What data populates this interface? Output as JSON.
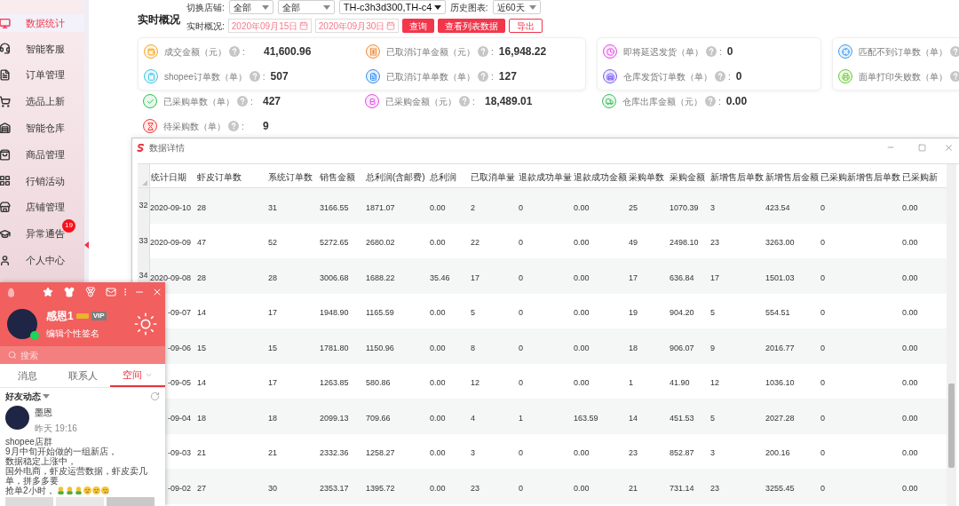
{
  "sidebar": {
    "items": [
      {
        "label": "数据统计",
        "selected": true
      },
      {
        "label": "智能客服",
        "selected": false
      },
      {
        "label": "订单管理",
        "selected": false
      },
      {
        "label": "选品上新",
        "selected": false
      },
      {
        "label": "智能仓库",
        "selected": false
      },
      {
        "label": "商品管理",
        "selected": false
      },
      {
        "label": "行销活动",
        "selected": false
      },
      {
        "label": "店铺管理",
        "selected": false
      },
      {
        "label": "异常通告",
        "selected": false,
        "badge": "19"
      },
      {
        "label": "个人中心",
        "selected": false
      }
    ]
  },
  "overview": {
    "title": "实时概况",
    "filters": {
      "store_label": "切换店铺:",
      "store_selects": [
        "全部",
        "全部",
        "TH-c3h3d300,TH-c4"
      ],
      "history_label": "历史图表:",
      "history_select": "近60天",
      "range_label": "实时概况:",
      "start_date": "2020年09月15日",
      "end_date": "2020年09月30日",
      "buttons": [
        {
          "label": "查询",
          "kind": "primary"
        },
        {
          "label": "查看列表数据",
          "kind": "primary"
        },
        {
          "label": "导出",
          "kind": "outline"
        }
      ]
    },
    "stat_panels": [
      {
        "card_rows": [
          [
            {
              "label": "成交金额（元）",
              "separator": ":",
              "value": "41,600.96"
            },
            {
              "label": "已取消订单金额（元）",
              "separator": ":",
              "value": "16,948.22"
            }
          ],
          [
            {
              "label": "shopee订单数（单）",
              "separator": ":",
              "value": "507"
            },
            {
              "label": "已取消订单单数（单）",
              "separator": ":",
              "value": "127"
            }
          ]
        ],
        "rows_below": [
          [
            {
              "label": "已采购单数（单）",
              "separator": ":",
              "value": "427"
            },
            {
              "label": "已采购金额（元）",
              "separator": ":",
              "value": "18,489.01"
            }
          ],
          [
            {
              "label": "待采购数（单）",
              "separator": ":",
              "value": "9"
            }
          ]
        ]
      },
      {
        "card_rows": [
          [
            {
              "label": "即将延迟发货（单）",
              "separator": ":",
              "value": "0"
            }
          ],
          [
            {
              "label": "仓库发货订单数（单）",
              "separator": ":",
              "value": "0"
            }
          ]
        ],
        "rows_below": [
          [
            {
              "label": "仓库出库金额（元）",
              "separator": ":",
              "value": "0.00"
            }
          ]
        ]
      },
      {
        "card_rows": [
          [
            {
              "label": "匹配不到订单数（单）"
            }
          ],
          [
            {
              "label": "面单打印失败数（单）"
            }
          ]
        ]
      }
    ]
  },
  "data_window": {
    "title": "数据详情",
    "table": {
      "columns": [
        "统计日期",
        "虾皮订单数",
        "系统订单数",
        "销售金额",
        "总利润(含邮费)",
        "总利润",
        "已取消单量",
        "退款成功单量",
        "退款成功金额",
        "采购单数",
        "采购金额",
        "新增售后单数",
        "新增售后金额",
        "已采购新增售后单数",
        "已采购新"
      ],
      "rows": [
        {
          "row_number": "32",
          "cells": [
            "2020-09-10",
            "28",
            "31",
            "3166.55",
            "1871.07",
            "0.00",
            "2",
            "0",
            "0.00",
            "25",
            "1070.39",
            "3",
            "423.54",
            "0",
            "0.00"
          ]
        },
        {
          "row_number": "33",
          "cells": [
            "2020-09-09",
            "47",
            "52",
            "5272.65",
            "2680.02",
            "0.00",
            "22",
            "0",
            "0.00",
            "49",
            "2498.10",
            "23",
            "3263.00",
            "0",
            "0.00"
          ]
        },
        {
          "row_number": "34",
          "cells": [
            "2020-09-08",
            "28",
            "28",
            "3006.68",
            "1688.22",
            "35.46",
            "17",
            "0",
            "0.00",
            "17",
            "636.84",
            "17",
            "1501.03",
            "0",
            "0.00"
          ]
        },
        {
          "cells": [
            "-09-07",
            "14",
            "17",
            "1948.90",
            "1165.59",
            "0.00",
            "5",
            "0",
            "0.00",
            "19",
            "904.20",
            "5",
            "554.51",
            "0",
            "0.00"
          ]
        },
        {
          "cells": [
            "-09-06",
            "15",
            "15",
            "1781.80",
            "1150.96",
            "0.00",
            "8",
            "0",
            "0.00",
            "18",
            "906.07",
            "9",
            "2016.77",
            "0",
            "0.00"
          ]
        },
        {
          "cells": [
            "-09-05",
            "14",
            "17",
            "1263.85",
            "580.86",
            "0.00",
            "12",
            "0",
            "0.00",
            "1",
            "41.90",
            "12",
            "1036.10",
            "0",
            "0.00"
          ]
        },
        {
          "cells": [
            "-09-04",
            "18",
            "18",
            "2099.13",
            "709.66",
            "0.00",
            "4",
            "1",
            "163.59",
            "14",
            "451.53",
            "5",
            "2027.28",
            "0",
            "0.00"
          ]
        },
        {
          "cells": [
            "-09-03",
            "21",
            "21",
            "2332.36",
            "1258.27",
            "0.00",
            "3",
            "0",
            "0.00",
            "23",
            "852.87",
            "3",
            "200.16",
            "0",
            "0.00"
          ]
        },
        {
          "cells": [
            "-09-02",
            "27",
            "30",
            "2353.17",
            "1395.72",
            "0.00",
            "23",
            "0",
            "0.00",
            "21",
            "731.14",
            "23",
            "3255.45",
            "0",
            "0.00"
          ]
        }
      ]
    }
  },
  "chat_window": {
    "profile": {
      "name": "感恩1",
      "vip": "VIP",
      "signature": "编辑个性签名",
      "online": true
    },
    "search": {
      "placeholder": "搜索"
    },
    "tabs": [
      {
        "label": "消息",
        "selected": false
      },
      {
        "label": "联系人",
        "selected": false
      },
      {
        "label": "空间",
        "selected": true
      }
    ],
    "feed": {
      "title": "好友动态",
      "posts": [
        {
          "author": "墨恩",
          "time": "昨天 19:16",
          "lines": [
            "shopee店群",
            "9月中旬开始做的一组新店，",
            "数据稳定上涨中，",
            "国外电商，虾皮运营数据，虾皮卖几单，拼多多要",
            "抢单2小时，"
          ]
        }
      ]
    }
  }
}
